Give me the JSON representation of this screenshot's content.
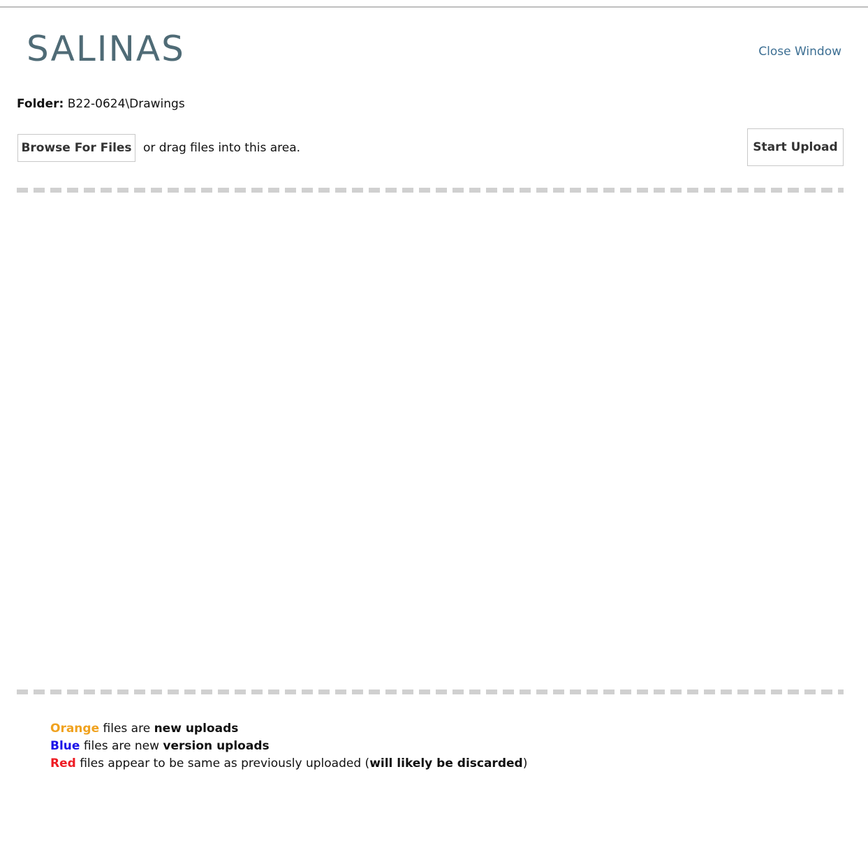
{
  "header": {
    "logo_text": "SALINAS",
    "close_window": "Close Window"
  },
  "folder": {
    "label": "Folder:",
    "path": "B22-0624\\Drawings"
  },
  "upload": {
    "browse_label": "Browse For Files",
    "drag_hint": "or drag files into this area.",
    "start_label": "Start Upload"
  },
  "legend": {
    "orange": {
      "color_word": "Orange",
      "text": " files are ",
      "emphasis": "new uploads",
      "color": "#f0a21f"
    },
    "blue": {
      "color_word": "Blue",
      "text": " files are new ",
      "emphasis": "version uploads",
      "color": "#1b12e8"
    },
    "red": {
      "color_word": "Red",
      "text": " files appear to be same as previously uploaded (",
      "emphasis": "will likely be discarded",
      "tail": ")",
      "color": "#ee1c24"
    }
  },
  "colors": {
    "logo": "#4f6b76",
    "link": "#3d6f93",
    "dash": "#d0d0d0"
  }
}
